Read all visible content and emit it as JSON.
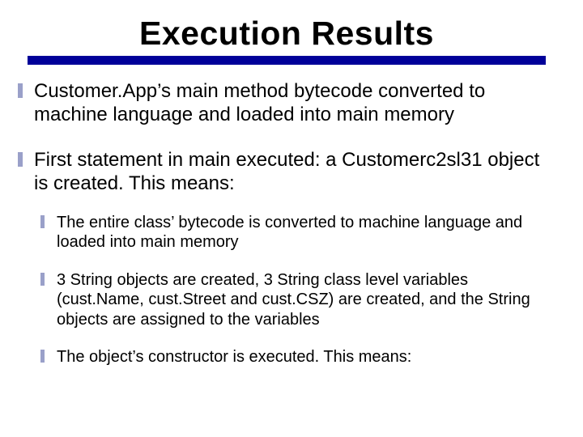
{
  "title": "Execution Results",
  "bullets": [
    {
      "text": "Customer.App’s main method bytecode converted to machine language and loaded into main memory"
    },
    {
      "text": "First statement in main executed: a Customerc2sl31 object is created.  This means:",
      "sub": [
        "The entire class’ bytecode is converted to machine language and loaded into main memory",
        "3 String objects are created, 3 String class level variables (cust.Name, cust.Street and cust.CSZ) are created, and the String objects are assigned to the variables",
        "The object’s constructor is executed.  This means:"
      ]
    }
  ]
}
